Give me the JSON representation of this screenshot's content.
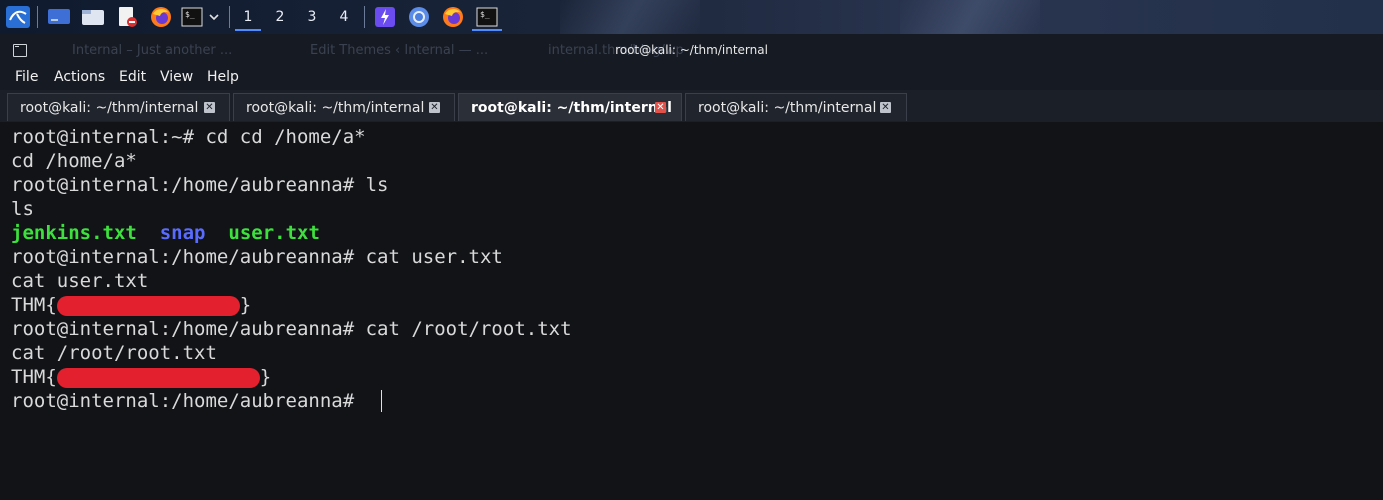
{
  "taskbar": {
    "workspaces": [
      "1",
      "2",
      "3",
      "4"
    ],
    "icons": [
      "kali-menu-icon",
      "show-desktop-icon",
      "file-manager-icon",
      "text-editor-icon",
      "firefox-icon",
      "terminal-icon",
      "dropdown-chevron-icon",
      "burpsuite-icon",
      "chromium-icon",
      "firefox-icon",
      "terminal-icon"
    ]
  },
  "window": {
    "title": "root@kali: ~/thm/internal",
    "ghost_tabs": [
      "Internal – Just another ...",
      "Edit Themes ‹ Internal — ...",
      "internal.thm/blog/wp-..."
    ]
  },
  "menu": [
    "File",
    "Actions",
    "Edit",
    "View",
    "Help"
  ],
  "tabs": [
    {
      "label": "root@kali: ~/thm/internal",
      "active": false
    },
    {
      "label": "root@kali: ~/thm/internal",
      "active": false
    },
    {
      "label": "root@kali: ~/thm/internal",
      "active": true
    },
    {
      "label": "root@kali: ~/thm/internal",
      "active": false
    }
  ],
  "terminal": {
    "l1": "root@internal:~# cd cd /home/a*",
    "l2": "cd /home/a*",
    "l3": "root@internal:/home/aubreanna# ls",
    "l4": "ls",
    "ls_files": [
      "jenkins.txt",
      "snap",
      "user.txt"
    ],
    "l6": "root@internal:/home/aubreanna# cat user.txt",
    "l7": "cat user.txt",
    "flag1_open": "THM{",
    "flag1_close": "}",
    "l9": "root@internal:/home/aubreanna# cat /root/root.txt",
    "l10": "cat /root/root.txt",
    "flag2_open": "THM{",
    "flag2_close": "}",
    "prompt": "root@internal:/home/aubreanna# "
  },
  "colors": {
    "accent": "#4f8cff",
    "ls_green": "#3de03d",
    "ls_blue": "#5a6cff",
    "redaction": "#e3202e"
  }
}
